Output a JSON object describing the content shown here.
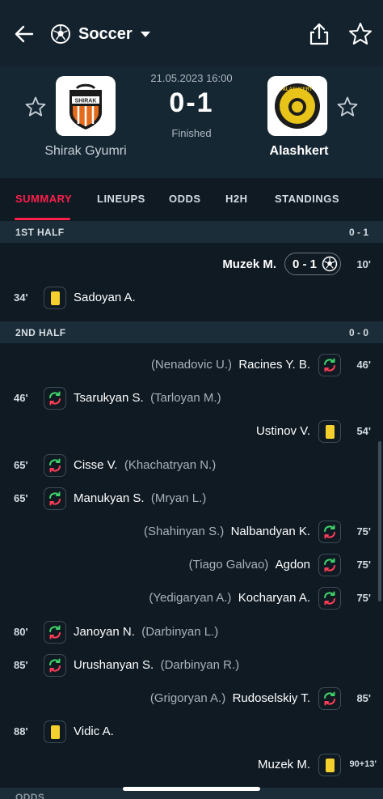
{
  "header": {
    "sport": "Soccer"
  },
  "match": {
    "date": "21.05.2023 16:00",
    "score": "0-1",
    "status": "Finished",
    "home": "Shirak Gyumri",
    "away": "Alashkert",
    "home_logo_text": "SHIRAK",
    "away_logo_text": "ALASHKERT"
  },
  "tabs": [
    "SUMMARY",
    "LINEUPS",
    "ODDS",
    "H2H",
    "STANDINGS"
  ],
  "first_half": {
    "title": "1ST HALF",
    "score": "0 - 1"
  },
  "goal": {
    "player": "Muzek M.",
    "score": "0 - 1",
    "minute": "10'"
  },
  "card1": {
    "minute": "34'",
    "player": "Sadoyan A."
  },
  "second_half": {
    "title": "2ND HALF",
    "score": "0 - 0"
  },
  "events": [
    {
      "side": "r",
      "type": "sub",
      "minute": "46'",
      "player": "Racines Y. B.",
      "assist": "(Nenadovic U.)"
    },
    {
      "side": "l",
      "type": "sub",
      "minute": "46'",
      "player": "Tsarukyan S.",
      "assist": "(Tarloyan M.)"
    },
    {
      "side": "r",
      "type": "card",
      "minute": "54'",
      "player": "Ustinov V.",
      "assist": ""
    },
    {
      "side": "l",
      "type": "sub",
      "minute": "65'",
      "player": "Cisse V.",
      "assist": "(Khachatryan N.)"
    },
    {
      "side": "l",
      "type": "sub",
      "minute": "65'",
      "player": "Manukyan S.",
      "assist": "(Mryan L.)"
    },
    {
      "side": "r",
      "type": "sub",
      "minute": "75'",
      "player": "Nalbandyan K.",
      "assist": "(Shahinyan S.)"
    },
    {
      "side": "r",
      "type": "sub",
      "minute": "75'",
      "player": "Agdon",
      "assist": "(Tiago Galvao)"
    },
    {
      "side": "r",
      "type": "sub",
      "minute": "75'",
      "player": "Kocharyan A.",
      "assist": "(Yedigaryan A.)"
    },
    {
      "side": "l",
      "type": "sub",
      "minute": "80'",
      "player": "Janoyan N.",
      "assist": "(Darbinyan L.)"
    },
    {
      "side": "l",
      "type": "sub",
      "minute": "85'",
      "player": "Urushanyan S.",
      "assist": "(Darbinyan R.)"
    },
    {
      "side": "r",
      "type": "sub",
      "minute": "85'",
      "player": "Rudoselskiy T.",
      "assist": "(Grigoryan A.)"
    },
    {
      "side": "l",
      "type": "card",
      "minute": "88'",
      "player": "Vidic A.",
      "assist": ""
    },
    {
      "side": "r",
      "type": "card",
      "minute": "90+13'",
      "player": "Muzek M.",
      "assist": ""
    }
  ],
  "next_section": "ODDS",
  "colors": {
    "accent": "#ff1f4b",
    "card": "#f5cf2c",
    "sub_in": "#3fd46a",
    "sub_out": "#ff3d57"
  }
}
